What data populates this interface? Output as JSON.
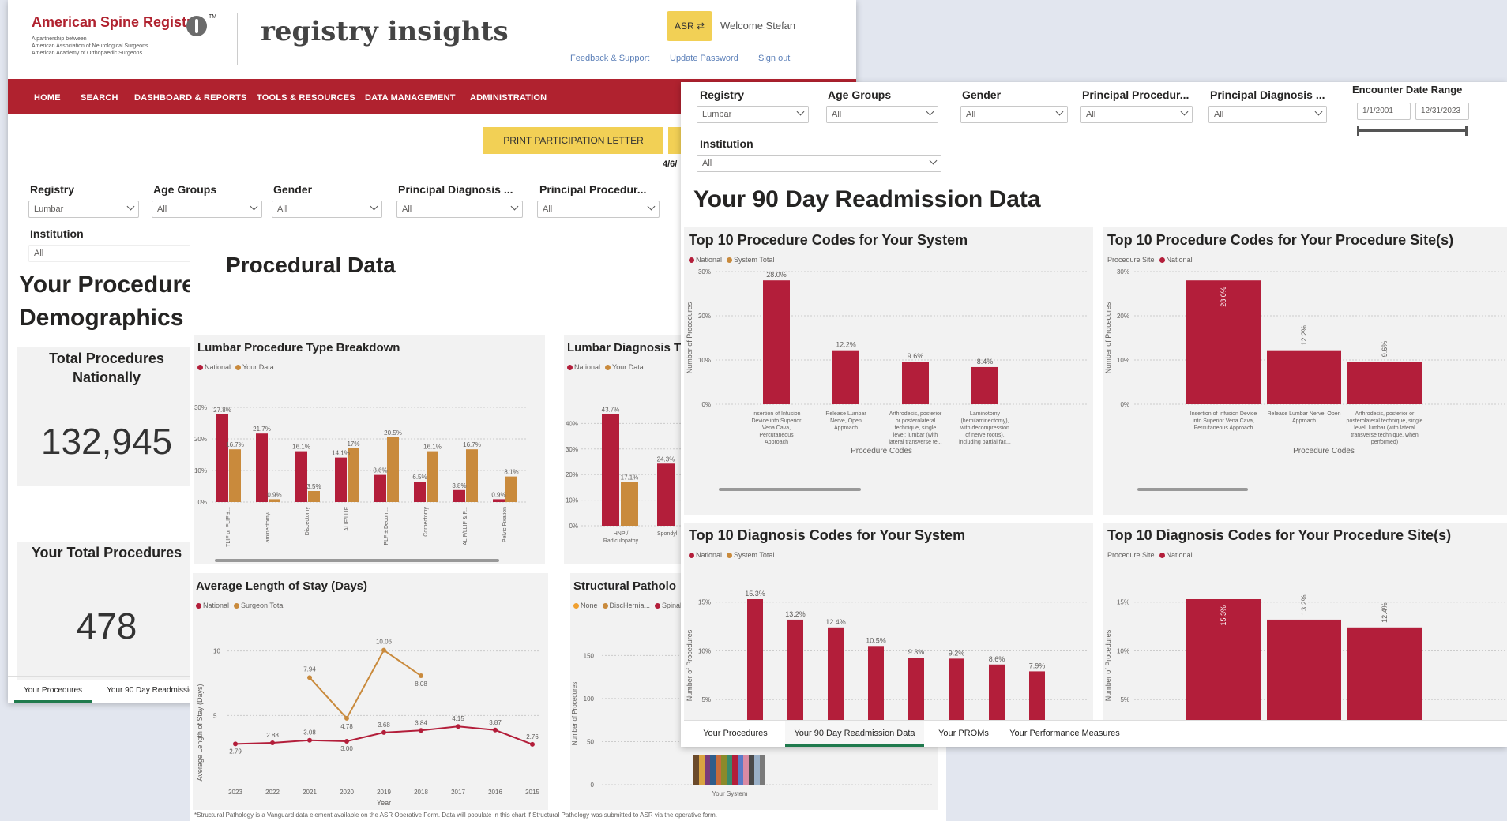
{
  "header": {
    "asr_logo": "American Spine Registry",
    "asr_tm": "TM",
    "asr_partnership": [
      "A partnership between",
      "American Association of Neurological Surgeons",
      "American Academy of Orthopaedic Surgeons"
    ],
    "ri_logo_a": "registry",
    "ri_logo_b": "insights",
    "asr_button": "ASR ⇄",
    "welcome": "Welcome Stefan",
    "links": [
      "Feedback & Support",
      "Update Password",
      "Sign out"
    ]
  },
  "nav": [
    "HOME",
    "SEARCH",
    "DASHBOARD & REPORTS",
    "TOOLS & RESOURCES",
    "DATA MANAGEMENT",
    "ADMINISTRATION"
  ],
  "print_button": "PRINT PARTICIPATION LETTER",
  "date_fragment": "4/6/",
  "left_filters": [
    {
      "label": "Registry",
      "value": "Lumbar"
    },
    {
      "label": "Age Groups",
      "value": "All"
    },
    {
      "label": "Gender",
      "value": "All"
    },
    {
      "label": "Principal Diagnosis ...",
      "value": "All"
    },
    {
      "label": "Principal Procedur...",
      "value": "All"
    }
  ],
  "left_institution": {
    "label": "Institution",
    "value": "All"
  },
  "demographics_title": [
    "Your Procedure",
    "Demographics"
  ],
  "total_nationally": {
    "label": [
      "Total Procedures",
      "Nationally"
    ],
    "value": "132,945"
  },
  "your_total": {
    "label": "Your Total Procedures",
    "value": "478"
  },
  "left_tabs": [
    "Your Procedures",
    "Your 90 Day Readmissio"
  ],
  "procedural_title": "Procedural Data",
  "lumbar_type": {
    "title": "Lumbar Procedure Type Breakdown",
    "legend": [
      "National",
      "Your Data"
    ],
    "categories": [
      "TLIF or PLIF ±...",
      "Laminectomy/...",
      "Discectomy",
      "ALIF/LLIF",
      "PLF ± Decom...",
      "Corpectomy",
      "ALIF/LLIF & P...",
      "Pelvic Fixation"
    ],
    "national": [
      27.8,
      21.7,
      16.1,
      14.1,
      8.6,
      6.5,
      3.8,
      0.9
    ],
    "yours": [
      16.7,
      0.9,
      3.5,
      17.0,
      20.5,
      16.1,
      16.7,
      8.1
    ],
    "yticks": [
      "0%",
      "10%",
      "20%",
      "30%"
    ]
  },
  "lumbar_dx": {
    "title": "Lumbar Diagnosis T",
    "legend": [
      "National",
      "Your Data"
    ],
    "categories": [
      "HNP / Radiculopathy",
      "Spondyl"
    ],
    "national": [
      43.7,
      24.3
    ],
    "yours": [
      17.1
    ],
    "yticks": [
      "0%",
      "10%",
      "20%",
      "30%",
      "40%"
    ]
  },
  "los": {
    "title": "Average Length of Stay (Days)",
    "legend": [
      "National",
      "Surgeon Total"
    ],
    "ylabel": "Average Length of Stay (Days)",
    "xlabel": "Year",
    "years": [
      "2023",
      "2022",
      "2021",
      "2020",
      "2019",
      "2018",
      "2017",
      "2016",
      "2015"
    ],
    "national": [
      2.79,
      2.88,
      3.08,
      3.0,
      3.68,
      3.84,
      4.15,
      3.87,
      2.76
    ],
    "surgeon": [
      null,
      null,
      7.94,
      4.78,
      10.06,
      8.08,
      null,
      null,
      null
    ],
    "yticks": [
      "5",
      "10"
    ]
  },
  "structural": {
    "title": "Structural Patholo",
    "legend": [
      "None",
      "DiscHernia...",
      "SpinalSt"
    ],
    "ylabel": "Number of Procedures",
    "xlabel": "Your System",
    "yticks": [
      "0",
      "50",
      "100",
      "150"
    ],
    "footnote": "*Structural Pathology is a Vanguard data element available on the ASR Operative Form. Data will populate in this chart if Structural Pathology was submitted to ASR via the operative form."
  },
  "right_filters": [
    {
      "label": "Registry",
      "value": "Lumbar"
    },
    {
      "label": "Age Groups",
      "value": "All"
    },
    {
      "label": "Gender",
      "value": "All"
    },
    {
      "label": "Principal Procedur...",
      "value": "All"
    },
    {
      "label": "Principal Diagnosis ...",
      "value": "All"
    }
  ],
  "right_institution": {
    "label": "Institution",
    "value": "All"
  },
  "date_range": {
    "label": "Encounter Date Range",
    "start": "1/1/2001",
    "end": "12/31/2023"
  },
  "readmission_title": "Your 90 Day Readmission Data",
  "proc_system": {
    "title": "Top 10 Procedure Codes for Your System",
    "legend": [
      "National",
      "System Total"
    ],
    "xlabel": "Procedure Codes",
    "ylabel": "Number of Procedures",
    "yticks": [
      "0%",
      "10%",
      "20%",
      "30%"
    ],
    "categories": [
      [
        "Insertion of Infusion",
        "Device into Superior",
        "Vena Cava,",
        "Percutaneous",
        "Approach"
      ],
      [
        "Release Lumbar",
        "Nerve, Open",
        "Approach"
      ],
      [
        "Arthrodesis, posterior",
        "or posterolateral",
        "technique, single",
        "level; lumbar (with",
        "lateral transverse te..."
      ],
      [
        "Laminotomy",
        "(hemilaminectomy),",
        "with decompression",
        "of nerve root(s),",
        "including partial fac..."
      ]
    ],
    "values": [
      28.0,
      12.2,
      9.6,
      8.4
    ]
  },
  "proc_site": {
    "title": "Top 10 Procedure Codes for Your Procedure Site(s)",
    "legend": [
      "Procedure Site",
      "National"
    ],
    "xlabel": "Procedure Codes",
    "ylabel": "Number of Procedures",
    "yticks": [
      "0%",
      "10%",
      "20%",
      "30%"
    ],
    "categories": [
      [
        "Insertion of Infusion Device",
        "into Superior Vena Cava,",
        "Percutaneous Approach"
      ],
      [
        "Release Lumbar Nerve, Open",
        "Approach"
      ],
      [
        "Arthrodesis, posterior or",
        "posterolateral technique, single",
        "level; lumbar (with lateral",
        "transverse technique, when",
        "performed)"
      ]
    ],
    "values": [
      28.0,
      12.2,
      9.6
    ]
  },
  "dx_system": {
    "title": "Top 10 Diagnosis Codes for Your System",
    "legend": [
      "National",
      "System Total"
    ],
    "ylabel": "Number of Procedures",
    "yticks": [
      "5%",
      "10%",
      "15%"
    ],
    "values": [
      15.3,
      13.2,
      12.4,
      10.5,
      9.3,
      9.2,
      8.6,
      7.9
    ]
  },
  "dx_site": {
    "title": "Top 10 Diagnosis Codes for Your Procedure Site(s)",
    "legend": [
      "Procedure Site",
      "National"
    ],
    "ylabel": "Number of Procedures",
    "yticks": [
      "5%",
      "10%",
      "15%"
    ],
    "values": [
      15.3,
      13.2,
      12.4
    ]
  },
  "right_tabs": [
    "Your Procedures",
    "Your 90 Day Readmission Data",
    "Your PROMs",
    "Your Performance Measures"
  ],
  "colors": {
    "red": "#b31e3a",
    "gold": "#c98a3c",
    "nav": "#b0222f",
    "button": "#f2d055"
  }
}
